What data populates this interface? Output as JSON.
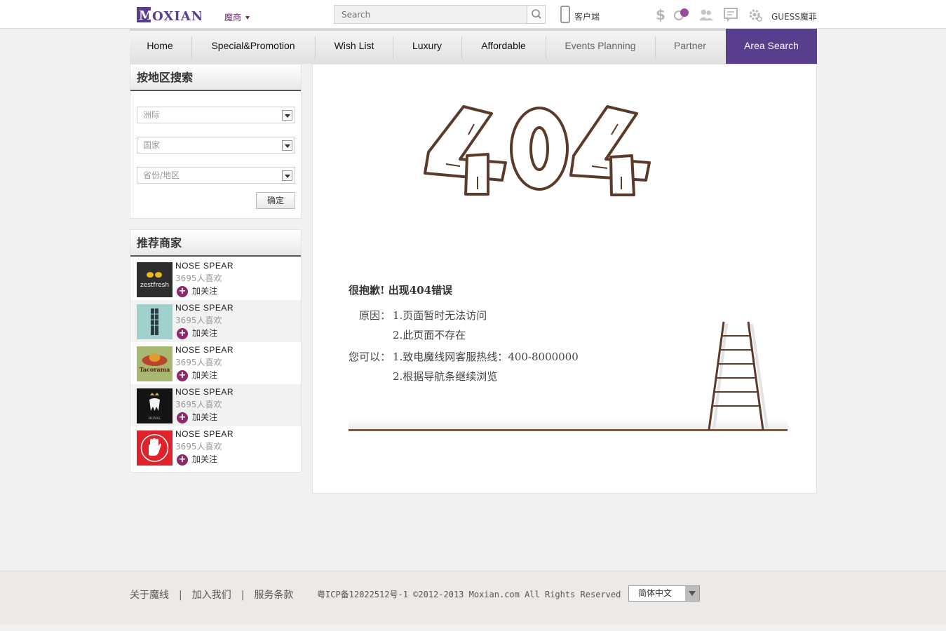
{
  "topbar": {
    "logo_text": "MOXIAN",
    "role_label": "魔商",
    "search_placeholder": "Search",
    "client_label": "客户端",
    "user_label": "GUESS魔菲"
  },
  "nav": {
    "items": [
      {
        "label": "Home"
      },
      {
        "label": "Special&Promotion"
      },
      {
        "label": "Wish List"
      },
      {
        "label": "Luxury"
      },
      {
        "label": "Affordable"
      },
      {
        "label": "Events Planning"
      },
      {
        "label": "Partner"
      },
      {
        "label": "Area Search"
      }
    ]
  },
  "area_search": {
    "title": "按地区搜索",
    "continent_placeholder": "洲际",
    "country_placeholder": "国家",
    "province_placeholder": "省份/地区",
    "confirm_label": "确定"
  },
  "recommended": {
    "title": "推荐商家",
    "merchants": [
      {
        "name": "NOSE SPEAR",
        "likes": "3695人喜欢",
        "follow": "加关注",
        "logo_text": "zestfresh"
      },
      {
        "name": "NOSE SPEAR",
        "likes": "3695人喜欢",
        "follow": "加关注",
        "logo_text": ""
      },
      {
        "name": "NOSE SPEAR",
        "likes": "3695人喜欢",
        "follow": "加关注",
        "logo_text": "Tacorama"
      },
      {
        "name": "NOSE SPEAR",
        "likes": "3695人喜欢",
        "follow": "加关注",
        "logo_text": "ROYAL"
      },
      {
        "name": "NOSE SPEAR",
        "likes": "3695人喜欢",
        "follow": "加关注",
        "logo_text": ""
      }
    ]
  },
  "error": {
    "code": "404",
    "title": "很抱歉! 出现404错误",
    "reason_label": "原因：",
    "reasons": [
      "1.页面暂时无法访问",
      "2.此页面不存在"
    ],
    "action_label": "您可以：",
    "actions": [
      "1.致电魔线网客服热线：400-8000000",
      "2.根据导航条继续浏览"
    ]
  },
  "footer": {
    "links": [
      "关于魔线",
      "加入我们",
      "服务条款"
    ],
    "copyright": "粤ICP备12022512号-1 ©2012-2013 Moxian.com All Rights Reserved",
    "language": "简体中文"
  },
  "colors": {
    "brand_purple": "#5a3e8e",
    "accent_magenta": "#8a2a6a",
    "wood_brown": "#5a3a2a"
  }
}
